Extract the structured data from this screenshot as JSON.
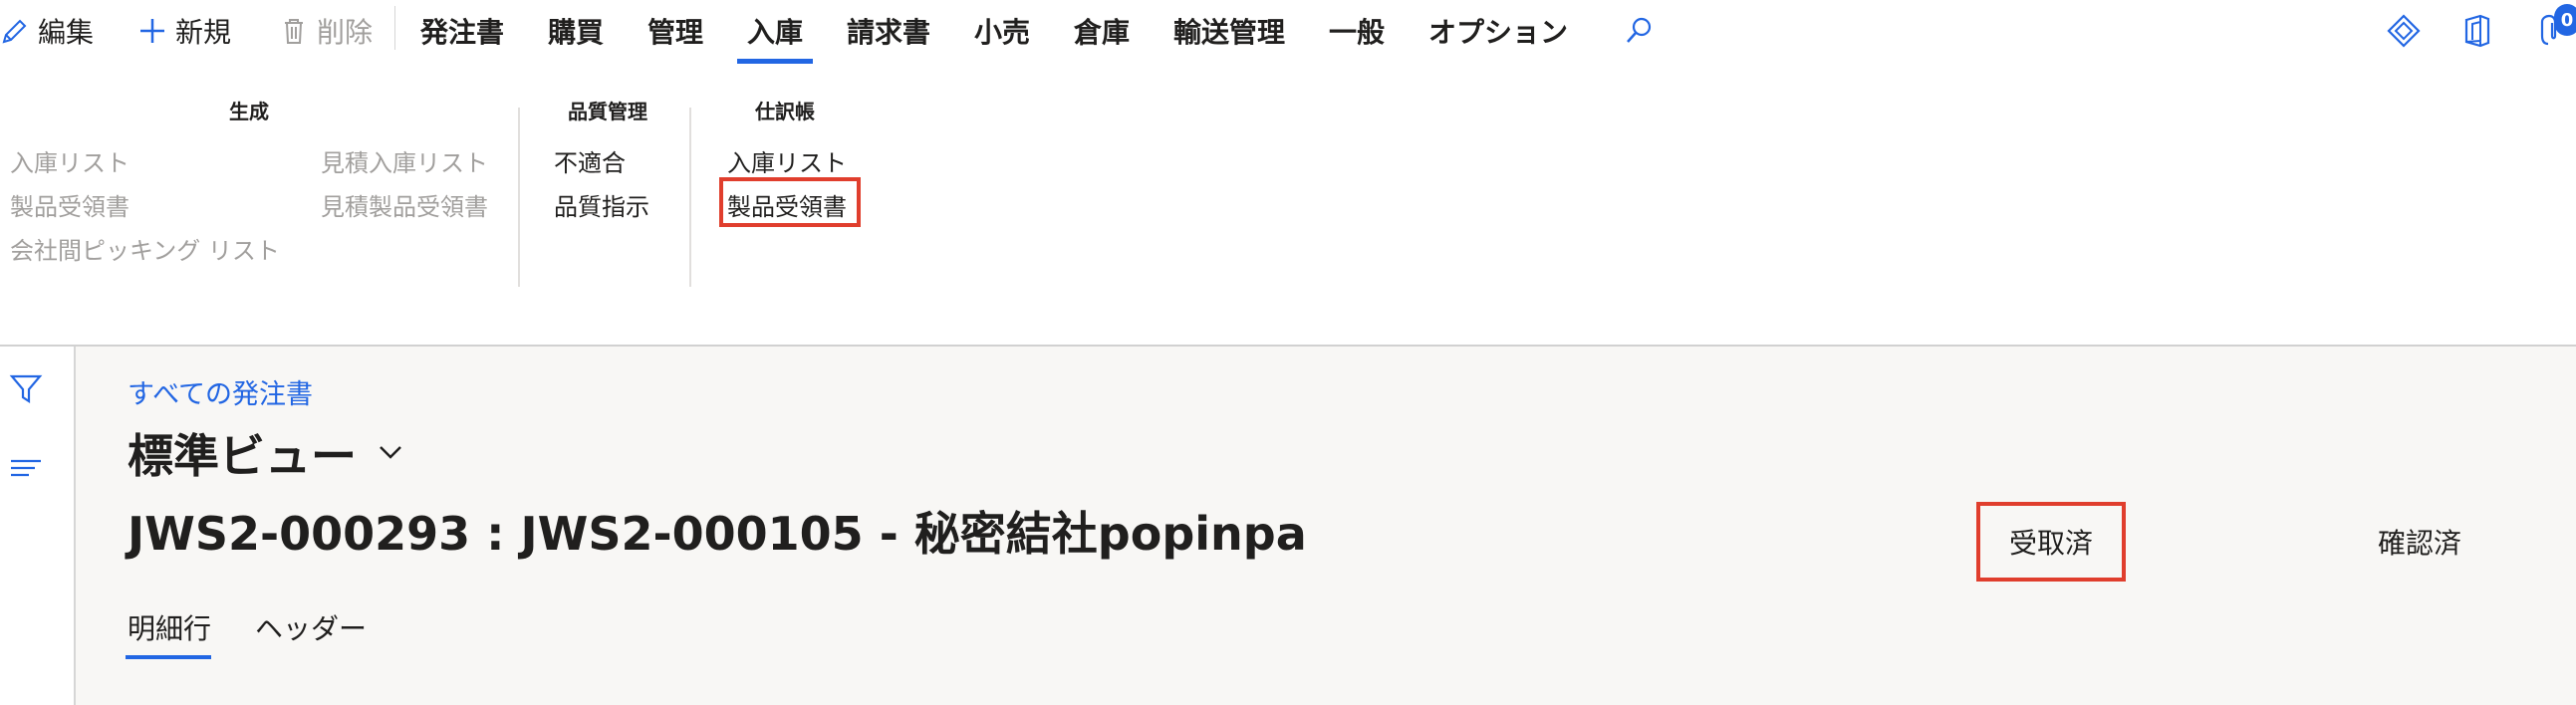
{
  "actions": {
    "edit_label": "編集",
    "new_label": "新規",
    "delete_label": "削除"
  },
  "tabs": [
    "発注書",
    "購買",
    "管理",
    "入庫",
    "請求書",
    "小売",
    "倉庫",
    "輸送管理",
    "一般",
    "オプション"
  ],
  "active_tab": "入庫",
  "notification_count": "0",
  "ribbon": {
    "group_generate": {
      "title": "生成",
      "items": [
        "入庫リスト",
        "製品受領書",
        "会社間ピッキング リスト",
        "見積入庫リスト",
        "見積製品受領書"
      ]
    },
    "group_quality": {
      "title": "品質管理",
      "items": [
        "不適合",
        "品質指示"
      ]
    },
    "group_journal": {
      "title": "仕訳帳",
      "items": [
        "入庫リスト",
        "製品受領書"
      ]
    }
  },
  "page": {
    "breadcrumb": "すべての発注書",
    "view_title": "標準ビュー",
    "record_title": "JWS2-000293 : JWS2-000105 - 秘密結社popinpa",
    "status_received": "受取済",
    "status_confirmed": "確認済",
    "page_tabs": [
      "明細行",
      "ヘッダー"
    ]
  },
  "colors": {
    "accent": "#2266e3",
    "highlight": "#e03e2d",
    "disabled": "#a19f9d"
  }
}
